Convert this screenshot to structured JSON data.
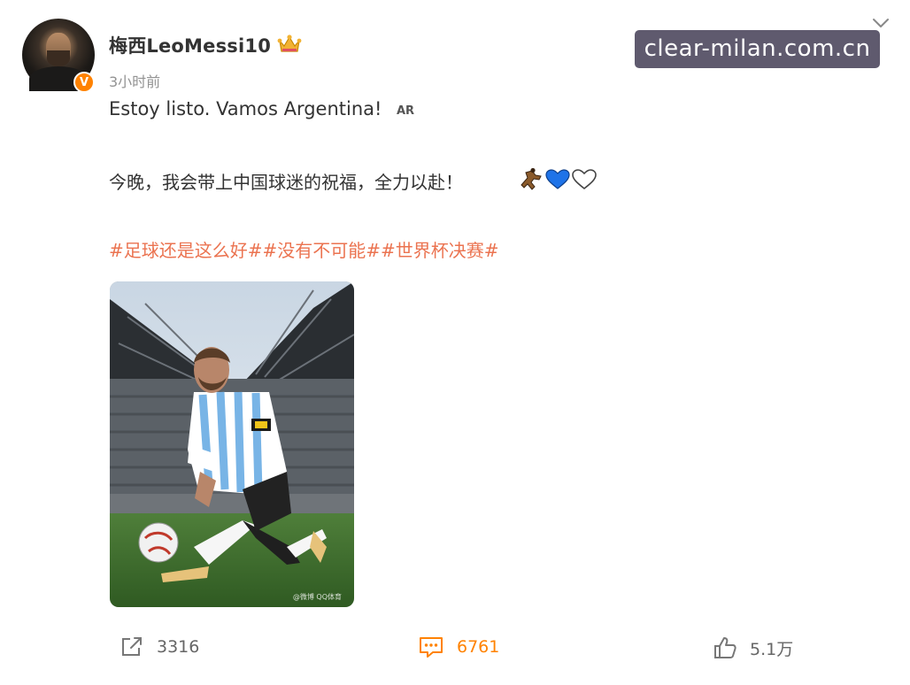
{
  "post": {
    "username": "梅西LeoMessi10",
    "timestamp": "3小时前",
    "text_line1": "Estoy listo. Vamos Argentina!",
    "ar_label": "AR",
    "text_line2": "今晚，我会带上中国球迷的祝福，全力以赴！",
    "hashtags": "#足球还是这么好##没有不可能##世界杯决赛#",
    "verified_badge": "V",
    "photo_credit": "@微博 QQ体育"
  },
  "watermark": "clear-milan.com.cn",
  "actions": {
    "repost_count": "3316",
    "comment_count": "6761",
    "like_count": "5.1万"
  },
  "colors": {
    "hashtag": "#eb7350",
    "accent_orange": "#ff8200",
    "muted": "#939393"
  },
  "icons": [
    "chevron-down-icon",
    "crown-icon",
    "verified-icon",
    "runner-emoji-icon",
    "blue-heart-icon",
    "white-heart-icon",
    "repost-icon",
    "comment-icon",
    "like-icon"
  ]
}
